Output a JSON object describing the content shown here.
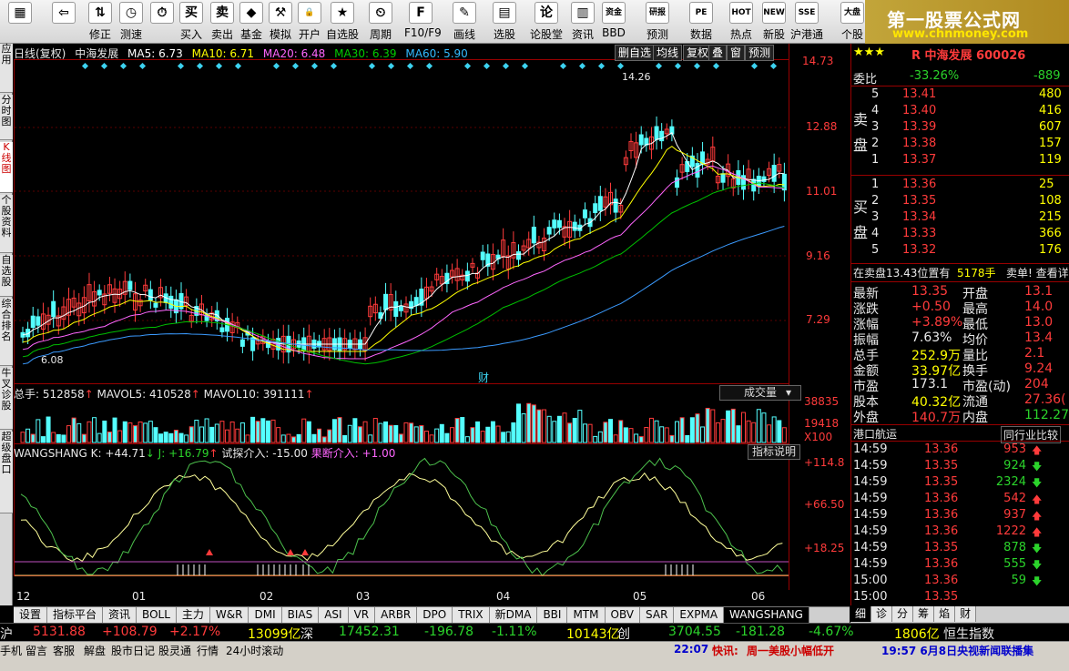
{
  "toolbar": {
    "items": [
      {
        "label": "",
        "icon": "grid-icon",
        "glyph": "▦"
      },
      {
        "label": "",
        "icon": "back-arrow-icon",
        "glyph": "⇦"
      },
      {
        "label": "修正",
        "icon": "adjust-icon",
        "glyph": "⇅"
      },
      {
        "label": "测速",
        "icon": "clock-icon",
        "glyph": "◷"
      },
      {
        "label": "",
        "icon": "timer-icon",
        "glyph": "⏱"
      },
      {
        "label": "买入",
        "icon": "buy-icon",
        "glyph": "买"
      },
      {
        "label": "卖出",
        "icon": "sell-icon",
        "glyph": "卖"
      },
      {
        "label": "基金",
        "icon": "fund-icon",
        "glyph": "◆"
      },
      {
        "label": "模拟",
        "icon": "hammer-icon",
        "glyph": "⚒"
      },
      {
        "label": "开户",
        "icon": "lock-icon",
        "glyph": "🔒"
      },
      {
        "label": "自选股",
        "icon": "star-folder-icon",
        "glyph": "★"
      },
      {
        "label": "周期",
        "icon": "period-icon",
        "glyph": "⏲"
      },
      {
        "label": "F10/F9",
        "icon": "f10-icon",
        "glyph": "F"
      },
      {
        "label": "画线",
        "icon": "pen-icon",
        "glyph": "✎"
      },
      {
        "label": "选股",
        "icon": "screen-icon",
        "glyph": "▤"
      },
      {
        "label": "论股堂",
        "icon": "discuss-icon",
        "glyph": "论"
      },
      {
        "label": "资讯",
        "icon": "news-icon",
        "glyph": "▥"
      },
      {
        "label": "BBD",
        "icon": "bbd-icon",
        "glyph": "资金"
      },
      {
        "label": "预测",
        "icon": "forecast-icon",
        "glyph": "研报"
      },
      {
        "label": "数据",
        "icon": "data-icon",
        "glyph": "PE"
      },
      {
        "label": "热点",
        "icon": "hot-icon",
        "glyph": "HOT"
      },
      {
        "label": "新股",
        "icon": "newstock-icon",
        "glyph": "NEW"
      },
      {
        "label": "沪港通",
        "icon": "hk-icon",
        "glyph": "SSE"
      },
      {
        "label": "个股",
        "icon": "market-icon",
        "glyph": "大盘"
      }
    ],
    "brand_title": "第一股票公式网",
    "brand_url": "www.chnmoney.com"
  },
  "left_tabs": [
    "应用",
    "分时图",
    "K线图",
    "个股资料",
    "自选股",
    "综合排名",
    "牛叉诊股",
    "超级盘口"
  ],
  "chart": {
    "legend": {
      "period": "日线(复权)",
      "name": "中海发展",
      "ma5": "MA5: 6.73",
      "ma10": "MA10: 6.71",
      "ma20": "MA20: 6.48",
      "ma30": "MA30: 6.39",
      "ma60": "MA60: 5.90"
    },
    "buttons": [
      "删自选",
      "均线",
      "复权",
      "叠",
      "窗",
      "预测"
    ],
    "price_axis": [
      "14.73",
      "12.88",
      "11.01",
      "9.16",
      "7.29"
    ],
    "high_label": "14.26",
    "low_label": "6.08",
    "marker": "财",
    "x_labels": [
      "12",
      "01",
      "02",
      "03",
      "04",
      "05",
      "06"
    ],
    "vol_legend": {
      "total": "总手: 512858",
      "mavol5": "MAVOL5: 410528",
      "mavol10": "MAVOL10: 391111"
    },
    "vol_dropdown": "成交量",
    "vol_axis": [
      "38835",
      "19418",
      "X100"
    ],
    "ind_legend": {
      "name": "WANGSHANG",
      "k": "K: +44.71",
      "j": "J: +16.79",
      "try": "试探介入: -15.00",
      "cut": "果断介入: +1.00"
    },
    "ind_button": "指标说明",
    "ind_axis": [
      "+114.8",
      "+66.50",
      "+18.25"
    ],
    "colors": {
      "up": "#ff3b3b",
      "down": "#54ffff",
      "ma5": "#ffffff",
      "ma10": "#ffff00",
      "ma20": "#ff66ff",
      "ma30": "#00c000",
      "ma60": "#3b9bff"
    }
  },
  "quote": {
    "stars": "★★★",
    "code_name": "R 中海发展 600026",
    "wb_label": "委比",
    "wb_pct": "-33.26%",
    "wb_val": "-889",
    "sell_label": [
      "卖",
      "盘"
    ],
    "buy_label": [
      "买",
      "盘"
    ],
    "sell": [
      [
        "5",
        "13.41",
        "480"
      ],
      [
        "4",
        "13.40",
        "416"
      ],
      [
        "3",
        "13.39",
        "607"
      ],
      [
        "2",
        "13.38",
        "157"
      ],
      [
        "1",
        "13.37",
        "119"
      ]
    ],
    "buy": [
      [
        "1",
        "13.36",
        "25"
      ],
      [
        "2",
        "13.35",
        "108"
      ],
      [
        "3",
        "13.34",
        "215"
      ],
      [
        "4",
        "13.33",
        "366"
      ],
      [
        "5",
        "13.32",
        "176"
      ]
    ],
    "notice": "在卖盘13.43位置有",
    "notice_val": "5178手",
    "notice_tail": "卖单! 查看详",
    "stats": [
      [
        "最新",
        "13.35",
        "开盘",
        "13.1"
      ],
      [
        "涨跌",
        "+0.50",
        "最高",
        "14.0"
      ],
      [
        "涨幅",
        "+3.89%",
        "最低",
        "13.0"
      ],
      [
        "振幅",
        "7.63%",
        "均价",
        "13.4"
      ],
      [
        "总手",
        "252.9万",
        "量比",
        "2.1"
      ],
      [
        "金额",
        "33.97亿",
        "换手",
        "9.24"
      ],
      [
        "市盈",
        "173.1",
        "市盈(动)",
        "204"
      ],
      [
        "股本",
        "40.32亿",
        "流通",
        "27.36("
      ],
      [
        "外盘",
        "140.7万",
        "内盘",
        "112.27"
      ]
    ],
    "sector": "港口航运",
    "sector_btn": "同行业比较",
    "ticks": [
      [
        "14:59",
        "13.36",
        "953",
        "up"
      ],
      [
        "14:59",
        "13.35",
        "924",
        "down"
      ],
      [
        "14:59",
        "13.35",
        "2324",
        "down"
      ],
      [
        "14:59",
        "13.36",
        "542",
        "up"
      ],
      [
        "14:59",
        "13.36",
        "937",
        "up"
      ],
      [
        "14:59",
        "13.36",
        "1222",
        "up"
      ],
      [
        "14:59",
        "13.35",
        "878",
        "down"
      ],
      [
        "14:59",
        "13.36",
        "555",
        "down"
      ],
      [
        "15:00",
        "13.36",
        "59",
        "down"
      ],
      [
        "15:00",
        "13.35",
        "",
        ""
      ]
    ],
    "right_tabs": [
      "细",
      "诊",
      "分",
      "筹",
      "焰",
      "财"
    ]
  },
  "bottom_tabs": [
    "设置",
    "指标平台",
    "资讯",
    "BOLL",
    "主力",
    "W&R",
    "DMI",
    "BIAS",
    "ASI",
    "VR",
    "ARBR",
    "DPO",
    "TRIX",
    "新DMA",
    "BBI",
    "MTM",
    "OBV",
    "SAR",
    "EXPMA",
    "WANGSHANG"
  ],
  "index_bar": {
    "sh_label": "沪",
    "sh": "5131.88",
    "sh_chg": "+108.79",
    "sh_pct": "+2.17%",
    "sh_amt": "13099亿",
    "sz_label": "深",
    "sz": "17452.31",
    "sz_chg": "-196.78",
    "sz_pct": "-1.11%",
    "sz_amt": "10143亿",
    "cy_label": "创",
    "cy": "3704.55",
    "cy_chg": "-181.28",
    "cy_pct": "-4.67%",
    "cy_amt": "1806亿",
    "hs_label": "恒生指数"
  },
  "status_bar": {
    "items": [
      "手机",
      "留言",
      "客服",
      "解盘",
      "股市日记",
      "股灵通",
      "行情",
      "24小时滚动"
    ],
    "time": "22:07",
    "news_label": "快讯:",
    "news": "周一美股小幅低开",
    "news2": "19:57 6月8日央视新闻联播集"
  }
}
